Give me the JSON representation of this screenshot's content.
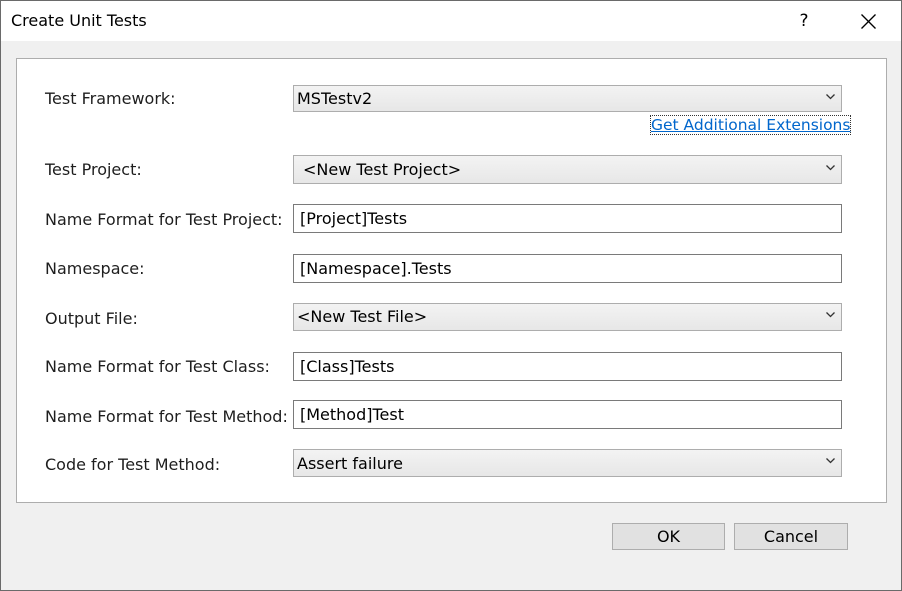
{
  "window": {
    "title": "Create Unit Tests",
    "help_glyph": "?",
    "close_icon": "close-icon"
  },
  "form": {
    "test_framework": {
      "label": "Test Framework:",
      "value": "MSTestv2"
    },
    "extensions_link": "Get Additional Extensions",
    "test_project": {
      "label": "Test Project:",
      "value": "<New Test Project>"
    },
    "name_format_project": {
      "label": "Name Format for Test Project:",
      "value": "[Project]Tests"
    },
    "namespace": {
      "label": "Namespace:",
      "value": "[Namespace].Tests"
    },
    "output_file": {
      "label": "Output File:",
      "value": "<New Test File>"
    },
    "name_format_class": {
      "label": "Name Format for Test Class:",
      "value": "[Class]Tests"
    },
    "name_format_method": {
      "label": "Name Format for Test Method:",
      "value": "[Method]Test"
    },
    "code_for_method": {
      "label": "Code for Test Method:",
      "value": "Assert failure"
    }
  },
  "buttons": {
    "ok": "OK",
    "cancel": "Cancel"
  },
  "colors": {
    "link": "#0066cc",
    "dialog_bg": "#f0f0f0",
    "panel_bg": "#ffffff"
  }
}
